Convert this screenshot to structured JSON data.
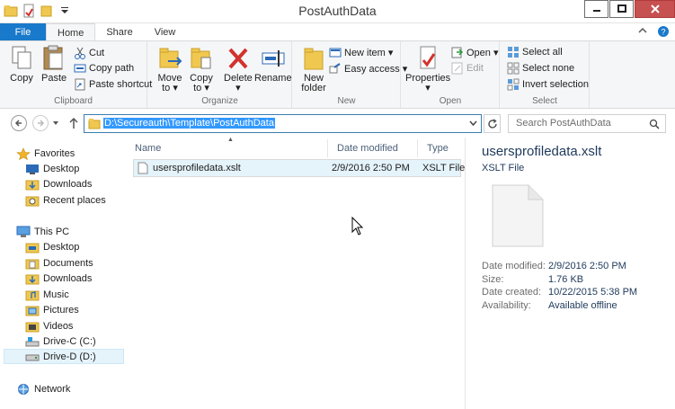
{
  "window": {
    "title": "PostAuthData"
  },
  "tabs": {
    "file": "File",
    "home": "Home",
    "share": "Share",
    "view": "View"
  },
  "ribbon": {
    "clipboard": {
      "label": "Clipboard",
      "copy": "Copy",
      "paste": "Paste",
      "cut": "Cut",
      "copy_path": "Copy path",
      "paste_shortcut": "Paste shortcut"
    },
    "organize": {
      "label": "Organize",
      "move_to": "Move\nto",
      "copy_to": "Copy\nto",
      "delete": "Delete",
      "rename": "Rename",
      "move_to_1": "Move",
      "move_to_2": "to ▾",
      "copy_to_1": "Copy",
      "copy_to_2": "to ▾",
      "delete_1": "Delete",
      "delete_2": "▾"
    },
    "new": {
      "label": "New",
      "new_folder_1": "New",
      "new_folder_2": "folder",
      "new_item": "New item ▾",
      "easy_access": "Easy access ▾"
    },
    "open": {
      "label": "Open",
      "properties_1": "Properties",
      "properties_2": "▾",
      "open": "Open ▾",
      "edit": "Edit"
    },
    "select": {
      "label": "Select",
      "select_all": "Select all",
      "select_none": "Select none",
      "invert_selection": "Invert selection"
    }
  },
  "address": {
    "path": "D:\\Secureauth\\Template\\PostAuthData",
    "search_placeholder": "Search PostAuthData"
  },
  "nav": {
    "favorites": "Favorites",
    "fav_items": [
      "Desktop",
      "Downloads",
      "Recent places"
    ],
    "this_pc": "This PC",
    "pc_items": [
      "Desktop",
      "Documents",
      "Downloads",
      "Music",
      "Pictures",
      "Videos",
      "Drive-C (C:)",
      "Drive-D (D:)"
    ],
    "network": "Network"
  },
  "list": {
    "columns": {
      "name": "Name",
      "date_modified": "Date modified",
      "type": "Type"
    },
    "rows": [
      {
        "name": "usersprofiledata.xslt",
        "date_modified": "2/9/2016 2:50 PM",
        "type": "XSLT File"
      }
    ]
  },
  "details": {
    "file_name": "usersprofiledata.xslt",
    "file_type": "XSLT File",
    "props": [
      {
        "key": "Date modified:",
        "value": "2/9/2016 2:50 PM"
      },
      {
        "key": "Size:",
        "value": "1.76 KB"
      },
      {
        "key": "Date created:",
        "value": "10/22/2015 5:38 PM"
      },
      {
        "key": "Availability:",
        "value": "Available offline"
      }
    ]
  },
  "colors": {
    "accent": "#1979ca",
    "selection": "#e5f3fb",
    "folder": "#f0c850",
    "close": "#c75050"
  }
}
